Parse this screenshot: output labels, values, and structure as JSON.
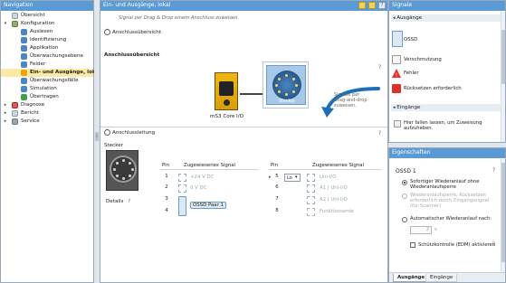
{
  "nav": {
    "title": "Navigation",
    "items": [
      {
        "label": "Übersicht"
      },
      {
        "label": "Konfiguration"
      },
      {
        "label": "Auslesen"
      },
      {
        "label": "Identifizierung"
      },
      {
        "label": "Applikation"
      },
      {
        "label": "Überwachungsebene"
      },
      {
        "label": "Felder"
      },
      {
        "label": "Ein- und Ausgänge, lokal"
      },
      {
        "label": "Überwachungsfälle"
      },
      {
        "label": "Simulation"
      },
      {
        "label": "Übertragen"
      },
      {
        "label": "Diagnose"
      },
      {
        "label": "Bericht"
      },
      {
        "label": "Service"
      }
    ]
  },
  "main": {
    "title": "Ein- und Ausgänge, lokal",
    "hint": "Signal per Drag & Drop einem Anschluss zuweisen.",
    "overview": {
      "section": "Anschlussübersicht",
      "subtitle": "Anschlussübersicht",
      "device_label": "mS3 Core I/O",
      "connector_label": "Stecker",
      "drag_hint": "Signale per Drag-and-drop zuweisen."
    },
    "wiring": {
      "section": "Anschlussleitung",
      "connector_title": "Stecker",
      "details_label": "Details",
      "left_table": {
        "col_pin": "Pin",
        "col_signal": "Zugewiesenes Signal",
        "rows": [
          {
            "pin": "1",
            "signal": "+24 V DC"
          },
          {
            "pin": "2",
            "signal": "0 V DC"
          },
          {
            "pin": "3",
            "signal": ""
          },
          {
            "pin": "4",
            "signal": "OSSD Paar 1"
          }
        ]
      },
      "right_table": {
        "col_pin": "Pin",
        "col_signal": "Zugewiesenes Signal",
        "rows": [
          {
            "pin": "5",
            "select_value": "Lo",
            "signal": "Uni-I/O"
          },
          {
            "pin": "6",
            "signal": "A1 | Uni-I/O"
          },
          {
            "pin": "7",
            "signal": "A2 | Uni-I/O"
          },
          {
            "pin": "8",
            "signal": "Funktionserde"
          }
        ]
      }
    }
  },
  "signals": {
    "title": "Signale",
    "outputs_label": "Ausgänge",
    "outputs": [
      {
        "label": "OSSD"
      },
      {
        "label": "Verschmutzung"
      },
      {
        "label": "Fehler"
      },
      {
        "label": "Rücksetzen erforderlich"
      }
    ],
    "inputs_label": "Eingänge",
    "inputs_hint": "Hier fallen lassen, um Zuweisung aufzuheben."
  },
  "props": {
    "title": "Eigenschaften",
    "heading": "OSSD 1",
    "options": [
      {
        "label": "Sofortiger Wiederanlauf ohne Wiederanlaufsperre"
      },
      {
        "label": "Wiederanlaufsperre, Rücksetzen erforderlich durch Eingangssignal (für Scanner)"
      },
      {
        "label": "Automatischer Wiederanlauf nach:"
      }
    ],
    "delay_value": "2",
    "delay_unit": "s",
    "edm_label": "Schützkontrolle (EDM) aktivieren",
    "tabs": [
      {
        "label": "Ausgänge"
      },
      {
        "label": "Eingänge"
      }
    ]
  },
  "colors": {
    "panel_title": "#5b9bd5",
    "selected_nav": "#fde9a6",
    "accent_blue": "#1f6fb8"
  }
}
